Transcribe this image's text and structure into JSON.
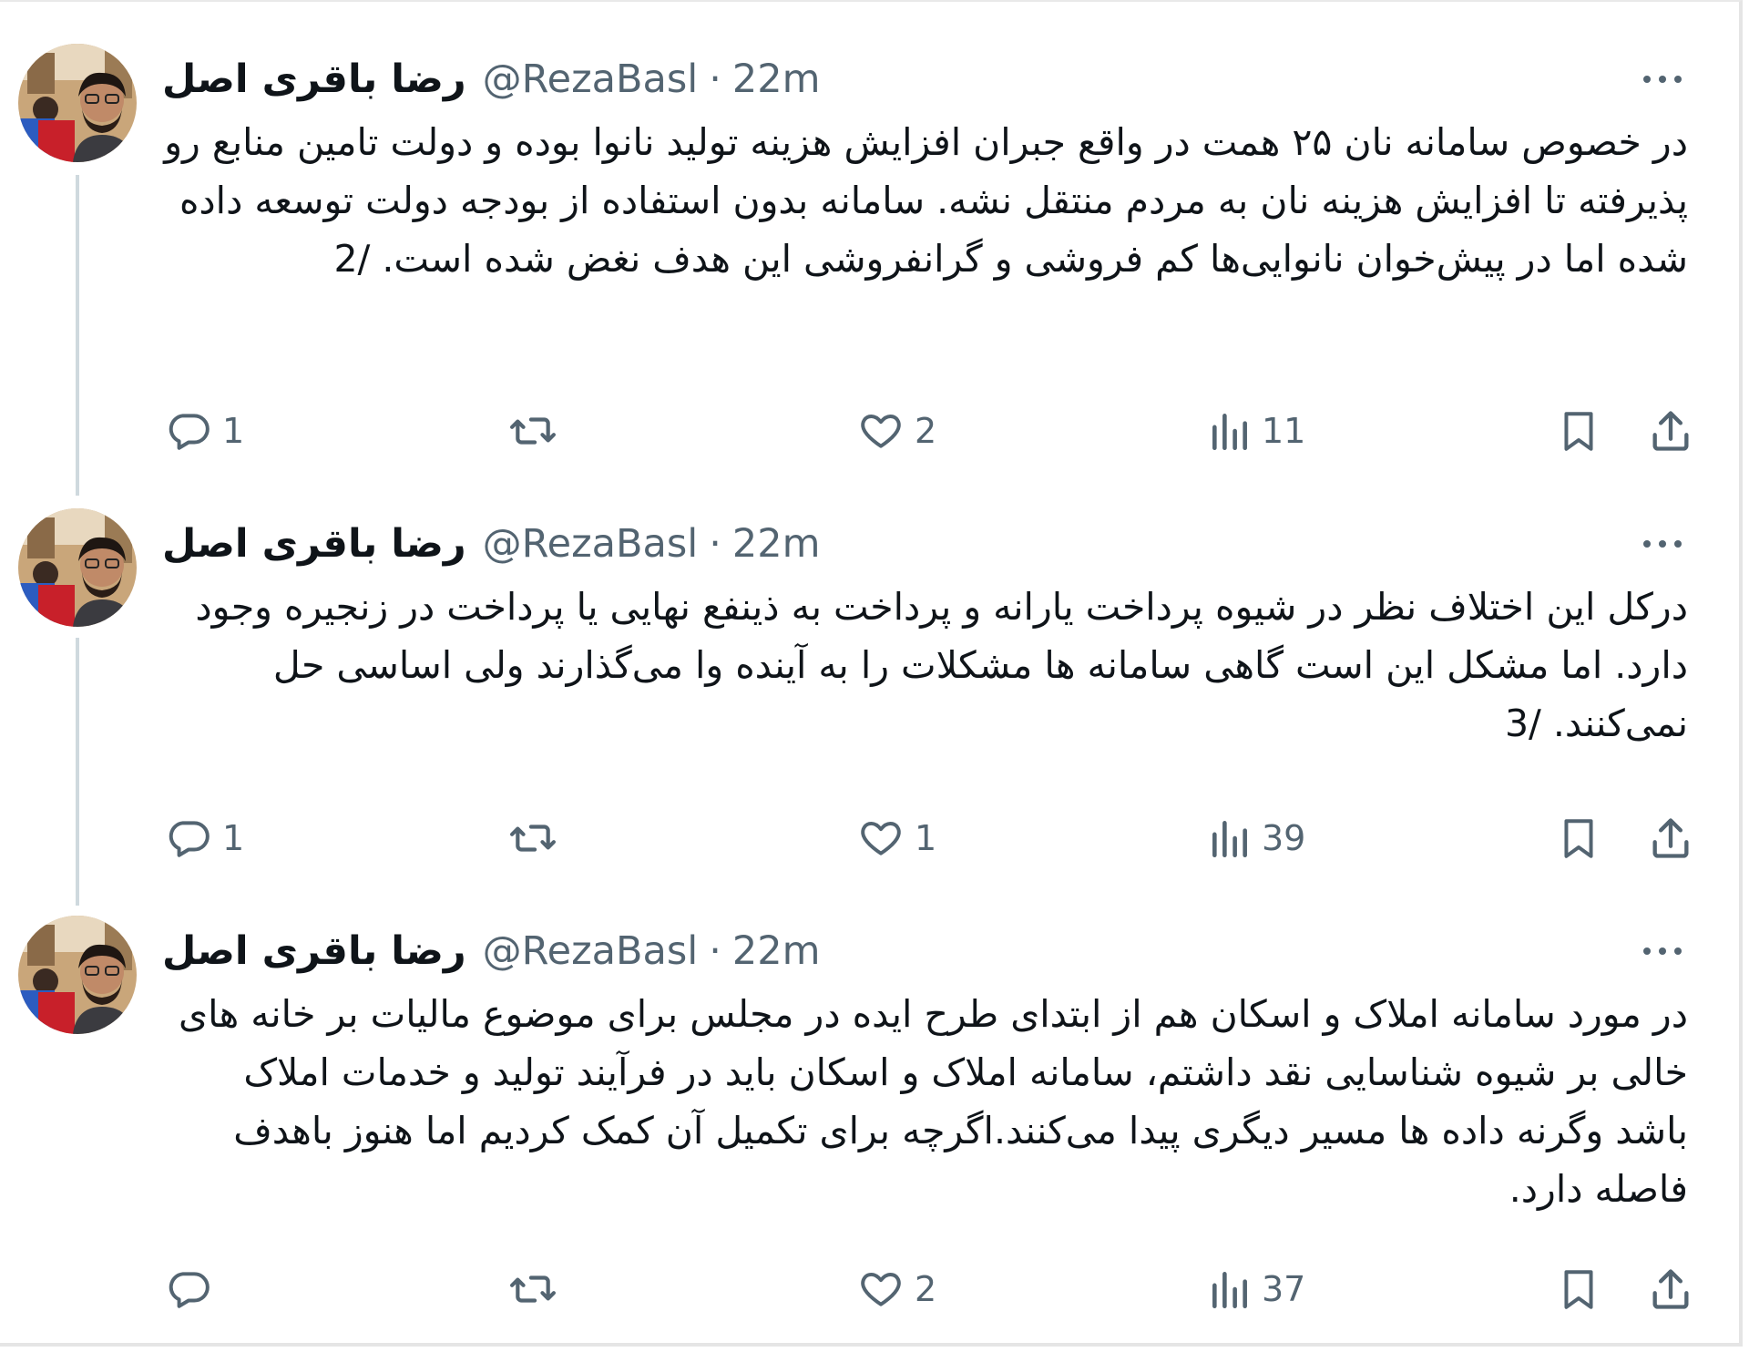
{
  "tweets": [
    {
      "author_name": "رضا باقری اصل",
      "handle": "@RezaBasl",
      "separator": "·",
      "time": "22m",
      "text": "در خصوص سامانه نان ۲۵ همت در واقع جبران افزایش هزینه تولید نانوا بوده و دولت تامین منابع رو پذیرفته تا افزایش هزینه نان به مردم منتقل نشه. سامانه بدون استفاده از بودجه  دولت توسعه داده شده اما در پیش‌خوان نانوایی‌ها کم فروشی و گرانفروشی این هدف نغض شده است. /2",
      "replies": "1",
      "retweets": "",
      "likes": "2",
      "views": "11"
    },
    {
      "author_name": "رضا باقری اصل",
      "handle": "@RezaBasl",
      "separator": "·",
      "time": "22m",
      "text": "درکل  این اختلاف نظر در شیوه پرداخت یارانه  و پرداخت به ذینفع نهایی یا پرداخت در زنجیره وجود دارد. اما مشکل این است گاهی سامانه ها مشکلات را به آینده وا می‌گذارند ولی اساسی حل نمی‌کنند. /3",
      "replies": "1",
      "retweets": "",
      "likes": "1",
      "views": "39"
    },
    {
      "author_name": "رضا باقری اصل",
      "handle": "@RezaBasl",
      "separator": "·",
      "time": "22m",
      "text": "در مورد سامانه املاک و اسکان هم از ابتدای طرح ایده در مجلس برای موضوع مالیات بر خانه های خالی بر شیوه شناسایی نقد داشتم، سامانه املاک و اسکان باید در فرآیند تولید و خدمات املاک باشد وگرنه داده ها مسیر دیگری پیدا می‌کنند.اگرچه برای تکمیل آن کمک کردیم اما هنوز باهدف فاصله دارد.",
      "replies": "",
      "retweets": "",
      "likes": "2",
      "views": "37"
    }
  ],
  "icons": {
    "reply": "reply-bubble-icon",
    "retweet": "retweet-arrows-icon",
    "like": "heart-icon",
    "views": "views-bar-chart-icon",
    "bookmark": "bookmark-icon",
    "share": "share-upload-icon",
    "more": "more-dots-icon"
  },
  "colors": {
    "text_primary": "#0f1419",
    "text_secondary": "#536471",
    "thread_line": "#cfd9de",
    "border": "#e5e5e5"
  }
}
